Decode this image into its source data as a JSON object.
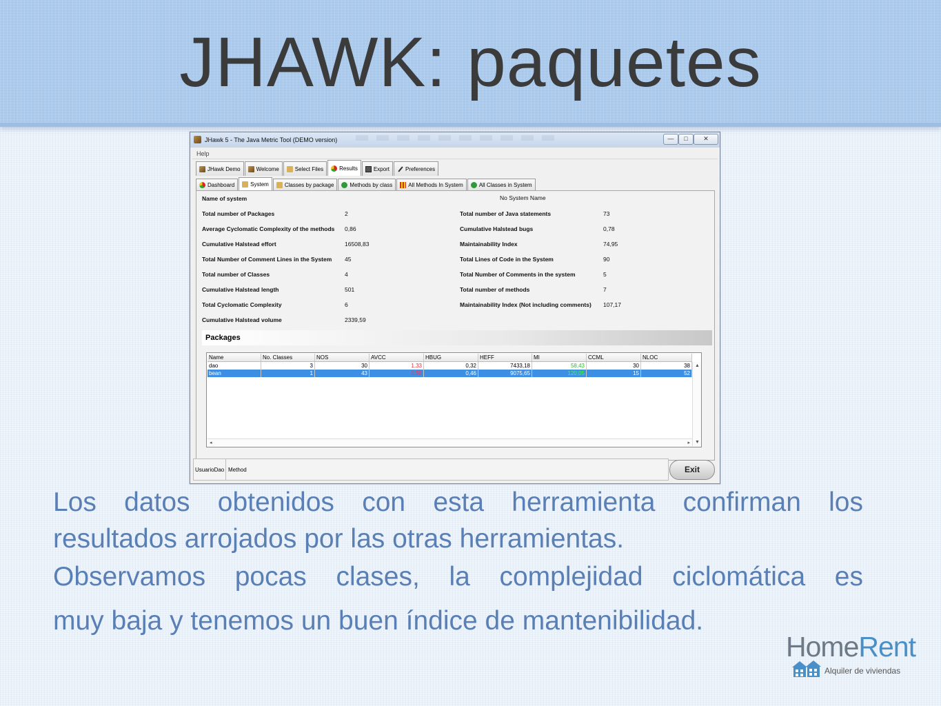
{
  "slide": {
    "title": "JHAWK: paquetes",
    "paragraph_lines": [
      "Los datos obtenidos con esta herramienta confirman los",
      "resultados arrojados por las otras herramientas.",
      "Observamos pocas clases, la complejidad ciclomática es",
      "muy baja y tenemos un buen índice de mantenibilidad."
    ]
  },
  "logo": {
    "word_home": "Home",
    "word_rent": "Rent",
    "tagline": "Alquiler de viviendas"
  },
  "window": {
    "title": "JHawk 5 - The Java Metric Tool (DEMO version)",
    "controls": {
      "minimize": "—",
      "maximize": "□",
      "close": "✕"
    },
    "menu": {
      "help": "Help"
    },
    "main_tabs": [
      {
        "label": "JHawk Demo",
        "icon": "jhawk-icon"
      },
      {
        "label": "Welcome",
        "icon": "jhawk-icon"
      },
      {
        "label": "Select Files",
        "icon": "folder-icon"
      },
      {
        "label": "Results",
        "icon": "pie-chart-icon",
        "active": true
      },
      {
        "label": "Export",
        "icon": "save-icon"
      },
      {
        "label": "Preferences",
        "icon": "wrench-icon"
      }
    ],
    "sub_tabs": [
      {
        "label": "Dashboard",
        "icon": "pie-chart-icon"
      },
      {
        "label": "System",
        "icon": "folder-icon",
        "active": true
      },
      {
        "label": "Classes by package",
        "icon": "folder-icon"
      },
      {
        "label": "Methods by class",
        "icon": "method-icon"
      },
      {
        "label": "All Methods In System",
        "icon": "grid-icon"
      },
      {
        "label": "All Classes in System",
        "icon": "method-icon"
      }
    ],
    "system": {
      "name_label": "Name of system",
      "name_value": "No System Name",
      "left_metrics": [
        {
          "label": "Total number of Packages",
          "value": "2"
        },
        {
          "label": "Average Cyclomatic Complexity of the methods",
          "value": "0,86"
        },
        {
          "label": "Cumulative Halstead effort",
          "value": "16508,83"
        },
        {
          "label": "Total Number of Comment Lines in the System",
          "value": "45"
        },
        {
          "label": "Total number of Classes",
          "value": "4"
        },
        {
          "label": "Cumulative Halstead length",
          "value": "501"
        },
        {
          "label": "Total Cyclomatic Complexity",
          "value": "6"
        },
        {
          "label": "Cumulative Halstead volume",
          "value": "2339,59"
        }
      ],
      "right_metrics": [
        {
          "label": "Total number of Java statements",
          "value": "73"
        },
        {
          "label": "Cumulative Halstead bugs",
          "value": "0,78"
        },
        {
          "label": "Maintainability Index",
          "value": "74,95"
        },
        {
          "label": "Total Lines of Code in the System",
          "value": "90"
        },
        {
          "label": "Total Number of Comments in the system",
          "value": "5"
        },
        {
          "label": "Total number of methods",
          "value": "7"
        },
        {
          "label": "Maintainability Index (Not including comments)",
          "value": "107,17"
        }
      ]
    },
    "packages": {
      "title": "Packages",
      "columns": [
        "Name",
        "No. Classes",
        "NOS",
        "AVCC",
        "HBUG",
        "HEFF",
        "MI",
        "CCML",
        "NLOC"
      ],
      "rows": [
        [
          "dao",
          "3",
          "30",
          "1,33",
          "0,32",
          "7433,18",
          "58,43",
          "30",
          "38"
        ],
        [
          "bean",
          "1",
          "43",
          "0,50",
          "0,46",
          "9075,65",
          "120,05",
          "15",
          "52"
        ]
      ],
      "selected_row": 1,
      "highlight_colors": {
        "avcc": "#e0303a",
        "mi": "#21c321",
        "selection": "#3d8fe3"
      }
    },
    "status": {
      "left": "UsuarioDao",
      "right": "Method"
    },
    "exit_label": "Exit"
  }
}
